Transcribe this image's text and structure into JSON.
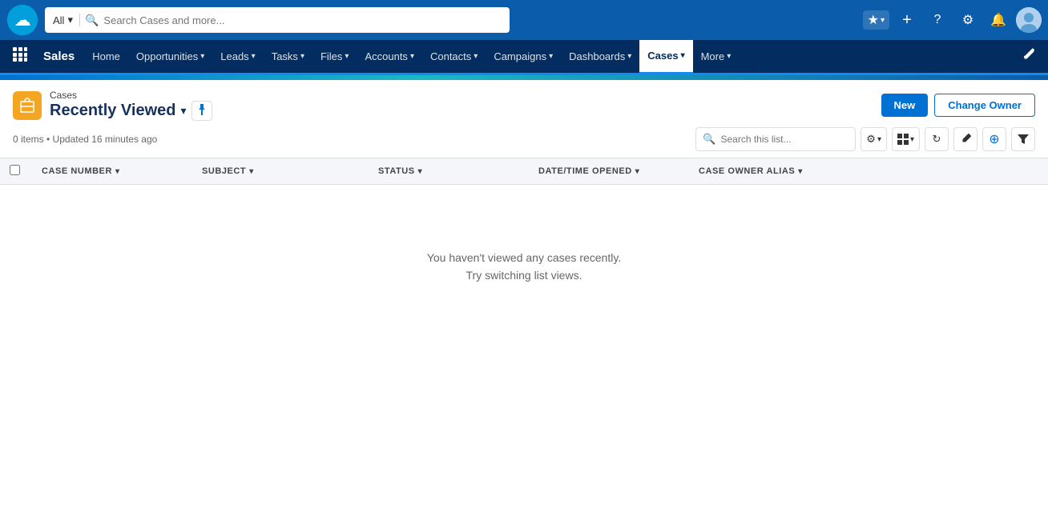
{
  "app": {
    "name": "Sales"
  },
  "topbar": {
    "search_placeholder": "Search Cases and more...",
    "search_dropdown_label": "All",
    "favorites_icon": "★",
    "add_icon": "+",
    "help_icon": "?",
    "settings_icon": "⚙",
    "notifications_icon": "🔔"
  },
  "nav": {
    "items": [
      {
        "label": "Home",
        "has_dropdown": false
      },
      {
        "label": "Opportunities",
        "has_dropdown": true
      },
      {
        "label": "Leads",
        "has_dropdown": true
      },
      {
        "label": "Tasks",
        "has_dropdown": true
      },
      {
        "label": "Files",
        "has_dropdown": true
      },
      {
        "label": "Accounts",
        "has_dropdown": true
      },
      {
        "label": "Contacts",
        "has_dropdown": true
      },
      {
        "label": "Campaigns",
        "has_dropdown": true
      },
      {
        "label": "Dashboards",
        "has_dropdown": true
      },
      {
        "label": "Cases",
        "has_dropdown": true,
        "active": true
      },
      {
        "label": "More",
        "has_dropdown": true
      }
    ]
  },
  "cases": {
    "breadcrumb": "Cases",
    "view_name": "Recently Viewed",
    "meta": "0 items • Updated 16 minutes ago",
    "search_placeholder": "Search this list...",
    "buttons": {
      "new": "New",
      "change_owner": "Change Owner"
    },
    "columns": [
      {
        "label": "Case Number"
      },
      {
        "label": "Subject"
      },
      {
        "label": "Status"
      },
      {
        "label": "Date/Time Opened"
      },
      {
        "label": "Case Owner Alias"
      }
    ],
    "empty_line1": "You haven't viewed any cases recently.",
    "empty_line2": "Try switching list views."
  }
}
